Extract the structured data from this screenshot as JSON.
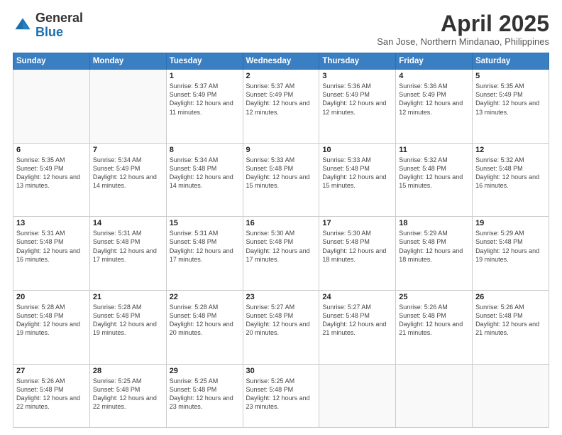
{
  "logo": {
    "general": "General",
    "blue": "Blue"
  },
  "header": {
    "month": "April 2025",
    "location": "San Jose, Northern Mindanao, Philippines"
  },
  "days_of_week": [
    "Sunday",
    "Monday",
    "Tuesday",
    "Wednesday",
    "Thursday",
    "Friday",
    "Saturday"
  ],
  "weeks": [
    [
      {
        "day": "",
        "info": ""
      },
      {
        "day": "",
        "info": ""
      },
      {
        "day": "1",
        "info": "Sunrise: 5:37 AM\nSunset: 5:49 PM\nDaylight: 12 hours and 11 minutes."
      },
      {
        "day": "2",
        "info": "Sunrise: 5:37 AM\nSunset: 5:49 PM\nDaylight: 12 hours and 12 minutes."
      },
      {
        "day": "3",
        "info": "Sunrise: 5:36 AM\nSunset: 5:49 PM\nDaylight: 12 hours and 12 minutes."
      },
      {
        "day": "4",
        "info": "Sunrise: 5:36 AM\nSunset: 5:49 PM\nDaylight: 12 hours and 12 minutes."
      },
      {
        "day": "5",
        "info": "Sunrise: 5:35 AM\nSunset: 5:49 PM\nDaylight: 12 hours and 13 minutes."
      }
    ],
    [
      {
        "day": "6",
        "info": "Sunrise: 5:35 AM\nSunset: 5:49 PM\nDaylight: 12 hours and 13 minutes."
      },
      {
        "day": "7",
        "info": "Sunrise: 5:34 AM\nSunset: 5:49 PM\nDaylight: 12 hours and 14 minutes."
      },
      {
        "day": "8",
        "info": "Sunrise: 5:34 AM\nSunset: 5:48 PM\nDaylight: 12 hours and 14 minutes."
      },
      {
        "day": "9",
        "info": "Sunrise: 5:33 AM\nSunset: 5:48 PM\nDaylight: 12 hours and 15 minutes."
      },
      {
        "day": "10",
        "info": "Sunrise: 5:33 AM\nSunset: 5:48 PM\nDaylight: 12 hours and 15 minutes."
      },
      {
        "day": "11",
        "info": "Sunrise: 5:32 AM\nSunset: 5:48 PM\nDaylight: 12 hours and 15 minutes."
      },
      {
        "day": "12",
        "info": "Sunrise: 5:32 AM\nSunset: 5:48 PM\nDaylight: 12 hours and 16 minutes."
      }
    ],
    [
      {
        "day": "13",
        "info": "Sunrise: 5:31 AM\nSunset: 5:48 PM\nDaylight: 12 hours and 16 minutes."
      },
      {
        "day": "14",
        "info": "Sunrise: 5:31 AM\nSunset: 5:48 PM\nDaylight: 12 hours and 17 minutes."
      },
      {
        "day": "15",
        "info": "Sunrise: 5:31 AM\nSunset: 5:48 PM\nDaylight: 12 hours and 17 minutes."
      },
      {
        "day": "16",
        "info": "Sunrise: 5:30 AM\nSunset: 5:48 PM\nDaylight: 12 hours and 17 minutes."
      },
      {
        "day": "17",
        "info": "Sunrise: 5:30 AM\nSunset: 5:48 PM\nDaylight: 12 hours and 18 minutes."
      },
      {
        "day": "18",
        "info": "Sunrise: 5:29 AM\nSunset: 5:48 PM\nDaylight: 12 hours and 18 minutes."
      },
      {
        "day": "19",
        "info": "Sunrise: 5:29 AM\nSunset: 5:48 PM\nDaylight: 12 hours and 19 minutes."
      }
    ],
    [
      {
        "day": "20",
        "info": "Sunrise: 5:28 AM\nSunset: 5:48 PM\nDaylight: 12 hours and 19 minutes."
      },
      {
        "day": "21",
        "info": "Sunrise: 5:28 AM\nSunset: 5:48 PM\nDaylight: 12 hours and 19 minutes."
      },
      {
        "day": "22",
        "info": "Sunrise: 5:28 AM\nSunset: 5:48 PM\nDaylight: 12 hours and 20 minutes."
      },
      {
        "day": "23",
        "info": "Sunrise: 5:27 AM\nSunset: 5:48 PM\nDaylight: 12 hours and 20 minutes."
      },
      {
        "day": "24",
        "info": "Sunrise: 5:27 AM\nSunset: 5:48 PM\nDaylight: 12 hours and 21 minutes."
      },
      {
        "day": "25",
        "info": "Sunrise: 5:26 AM\nSunset: 5:48 PM\nDaylight: 12 hours and 21 minutes."
      },
      {
        "day": "26",
        "info": "Sunrise: 5:26 AM\nSunset: 5:48 PM\nDaylight: 12 hours and 21 minutes."
      }
    ],
    [
      {
        "day": "27",
        "info": "Sunrise: 5:26 AM\nSunset: 5:48 PM\nDaylight: 12 hours and 22 minutes."
      },
      {
        "day": "28",
        "info": "Sunrise: 5:25 AM\nSunset: 5:48 PM\nDaylight: 12 hours and 22 minutes."
      },
      {
        "day": "29",
        "info": "Sunrise: 5:25 AM\nSunset: 5:48 PM\nDaylight: 12 hours and 23 minutes."
      },
      {
        "day": "30",
        "info": "Sunrise: 5:25 AM\nSunset: 5:48 PM\nDaylight: 12 hours and 23 minutes."
      },
      {
        "day": "",
        "info": ""
      },
      {
        "day": "",
        "info": ""
      },
      {
        "day": "",
        "info": ""
      }
    ]
  ]
}
